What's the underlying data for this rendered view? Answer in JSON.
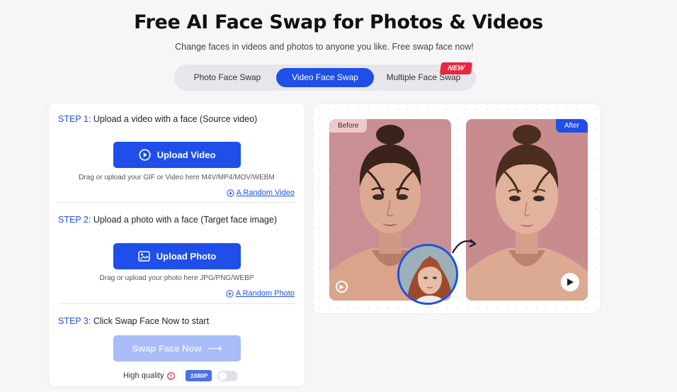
{
  "header": {
    "title": "Free AI Face Swap for Photos & Videos",
    "subtitle": "Change faces in videos and photos to anyone you like. Free swap face now!"
  },
  "tabs": [
    {
      "label": "Photo Face Swap",
      "active": false
    },
    {
      "label": "Video Face Swap",
      "active": true
    },
    {
      "label": "Multiple Face Swap",
      "active": false
    }
  ],
  "new_badge": "NEW",
  "step1": {
    "num": "STEP 1:",
    "text": "Upload a video with a face (Source video)",
    "button": "Upload Video",
    "hint": "Drag or upload your GIF or Video here M4V/MP4/MOV/WEBM",
    "random_link": "A Random Video"
  },
  "step2": {
    "num": "STEP 2:",
    "text": "Upload a photo with a face (Target face image)",
    "button": "Upload Photo",
    "hint": "Drag or upload your photo here JPG/PNG/WEBP",
    "random_link": "A Random Photo"
  },
  "step3": {
    "num": "STEP 3:",
    "text": "Click Swap Face Now to start",
    "button": "Swap Face Now",
    "arrow": "⟶"
  },
  "quality": {
    "label": "High quality",
    "badge": "1080P",
    "enabled": false
  },
  "preview": {
    "before_label": "Before",
    "after_label": "After"
  },
  "colors": {
    "accent": "#1f4fe8",
    "new_badge": "#e8283e",
    "disabled_button": "#a9bcf7"
  }
}
